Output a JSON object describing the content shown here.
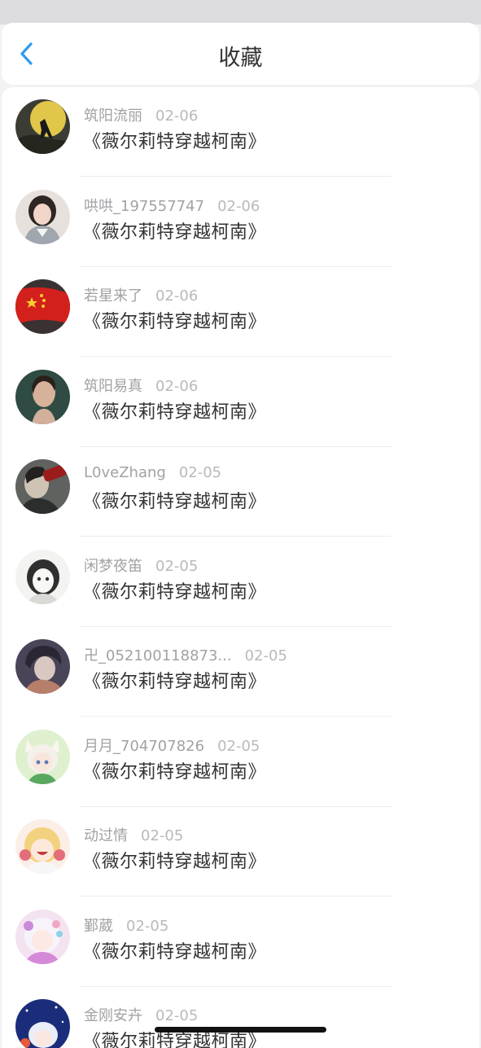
{
  "header": {
    "title": "收藏",
    "back_icon": "chevron-left-icon",
    "accent": "#2f9bf0"
  },
  "items": [
    {
      "user": "筑阳流丽",
      "date": "02-06",
      "title": "《薇尔莉特穿越柯南》",
      "avatar": "wolf-moon"
    },
    {
      "user": "哄哄_197557747",
      "date": "02-06",
      "title": "《薇尔莉特穿越柯南》",
      "avatar": "girl-photo"
    },
    {
      "user": "若星来了",
      "date": "02-06",
      "title": "《薇尔莉特穿越柯南》",
      "avatar": "china-flag"
    },
    {
      "user": "筑阳易真",
      "date": "02-06",
      "title": "《薇尔莉特穿越柯南》",
      "avatar": "woman-portrait"
    },
    {
      "user": "L0veZhang",
      "date": "02-05",
      "title": "《薇尔莉特穿越柯南》",
      "avatar": "drinking-man"
    },
    {
      "user": "闲梦夜笛",
      "date": "02-05",
      "title": "《薇尔莉特穿越柯南》",
      "avatar": "sketch-girl"
    },
    {
      "user": "卍_052100118873...",
      "date": "02-05",
      "title": "《薇尔莉特穿越柯南》",
      "avatar": "anime-boy"
    },
    {
      "user": "月月_704707826",
      "date": "02-05",
      "title": "《薇尔莉特穿越柯南》",
      "avatar": "cat-ear-boy"
    },
    {
      "user": "动过情",
      "date": "02-05",
      "title": "《薇尔莉特穿越柯南》",
      "avatar": "blonde-anime-girl"
    },
    {
      "user": "鄞葳",
      "date": "02-05",
      "title": "《薇尔莉特穿越柯南》",
      "avatar": "flower-anime-girl"
    },
    {
      "user": "金刚安卉",
      "date": "02-05",
      "title": "《薇尔莉特穿越柯南》",
      "avatar": "starry-anime"
    }
  ]
}
